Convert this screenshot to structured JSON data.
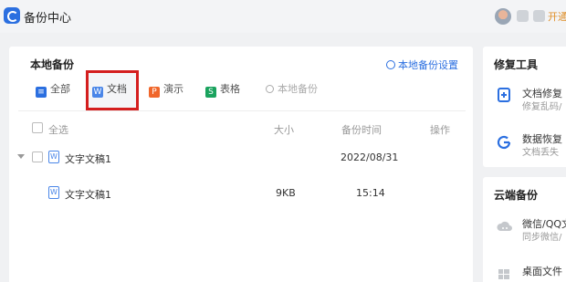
{
  "window": {
    "title": "备份中心",
    "vip_label": "开通"
  },
  "main": {
    "section_title": "本地备份",
    "settings_link": "本地备份设置",
    "tabs": [
      {
        "label": "全部",
        "icon": "list-icon"
      },
      {
        "label": "文档",
        "icon": "word-doc-icon",
        "selected": true
      },
      {
        "label": "演示",
        "icon": "ppt-icon"
      },
      {
        "label": "表格",
        "icon": "spreadsheet-icon"
      }
    ],
    "search_placeholder": "本地备份",
    "table": {
      "headers": {
        "select_all": "全选",
        "size": "大小",
        "time": "备份时间",
        "action": "操作"
      },
      "rows": [
        {
          "name": "文字文稿1",
          "size": "",
          "time": "2022/08/31"
        },
        {
          "name": "文字文稿1",
          "size": "9KB",
          "time": "15:14"
        }
      ]
    }
  },
  "repair_tools": {
    "title": "修复工具",
    "items": [
      {
        "name": "文档修复",
        "desc": "修复乱码/",
        "icon": "doc-repair-icon"
      },
      {
        "name": "数据恢复",
        "desc": "文档丢失",
        "icon": "data-recovery-icon"
      }
    ]
  },
  "cloud_backup": {
    "title": "云端备份",
    "items": [
      {
        "name": "微信/QQ文",
        "desc": "同步微信/",
        "icon": "wechat-cloud-icon"
      },
      {
        "name": "桌面文件",
        "desc": "",
        "icon": "windows-icon"
      }
    ]
  },
  "colors": {
    "accent": "#2b6fe0",
    "highlight": "#d41e1e",
    "vip": "#e0902a"
  }
}
